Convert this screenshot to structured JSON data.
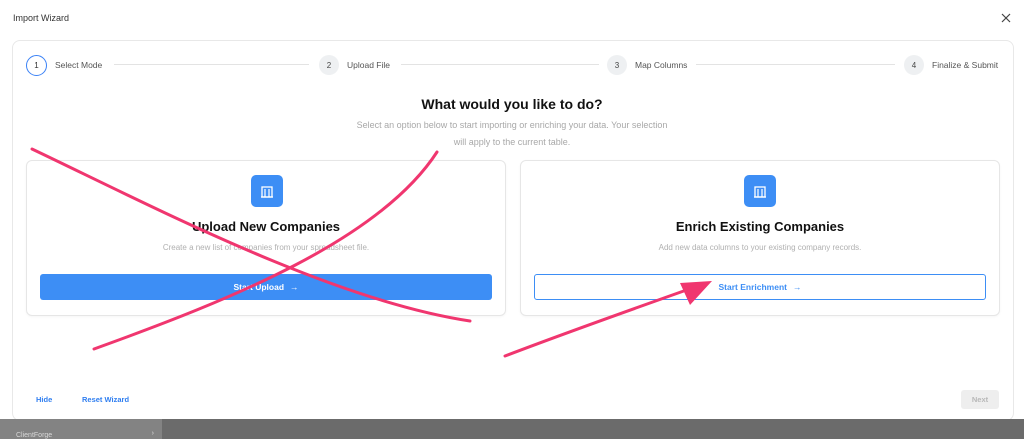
{
  "window": {
    "title": "Import Wizard",
    "close_icon": "close-icon"
  },
  "steps": [
    {
      "number": "1",
      "label": "Select Mode",
      "active": true
    },
    {
      "number": "2",
      "label": "Upload File",
      "active": false
    },
    {
      "number": "3",
      "label": "Map Columns",
      "active": false
    },
    {
      "number": "4",
      "label": "Finalize & Submit",
      "active": false
    }
  ],
  "main": {
    "heading": "What would you like to do?",
    "subheading": "Select an option below to start importing or enriching your data. Your selection will apply to the current table."
  },
  "cards": [
    {
      "icon": "building-icon",
      "title": "Upload New Companies",
      "description": "Create a new list of companies from your spreadsheet file.",
      "button_label": "Start Upload",
      "button_style": "primary"
    },
    {
      "icon": "building-icon",
      "title": "Enrich Existing Companies",
      "description": "Add new data columns to your existing company records.",
      "button_label": "Start Enrichment",
      "button_style": "outline"
    }
  ],
  "footer": {
    "hide_label": "Hide",
    "reset_label": "Reset Wizard",
    "next_label": "Next"
  },
  "background_app": {
    "tab_label": "ClientForge"
  },
  "colors": {
    "accent": "#3d8ef5",
    "annotation": "#f0366f"
  }
}
